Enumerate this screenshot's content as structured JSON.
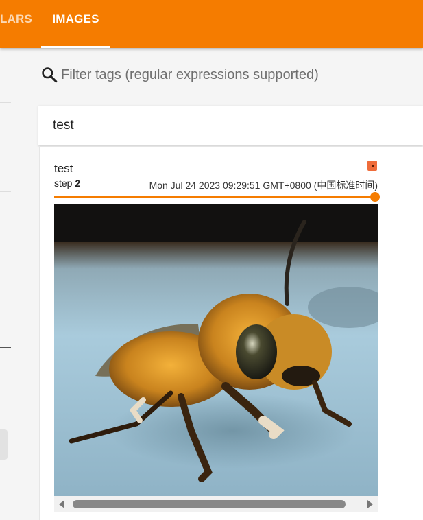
{
  "header": {
    "tabs": [
      {
        "label": "SCALARS",
        "visible_text": "LARS",
        "active": false
      },
      {
        "label": "IMAGES",
        "active": true
      }
    ]
  },
  "search": {
    "placeholder": "Filter tags (regular expressions supported)",
    "value": ""
  },
  "tag_group": {
    "title": "test"
  },
  "image_card": {
    "title": "test",
    "step_label": "step",
    "step_value": "2",
    "timestamp": "Mon Jul 24 2023 09:29:51 GMT+0800 (中国标准时间)",
    "slider_position": 1.0,
    "image_description_icon": "bee-photo"
  },
  "colors": {
    "brand": "#f57c00",
    "run_color": "#ef6c3a"
  },
  "icons": [
    "search-icon",
    "run-color-swatch",
    "scroll-left-arrow",
    "scroll-right-arrow"
  ]
}
